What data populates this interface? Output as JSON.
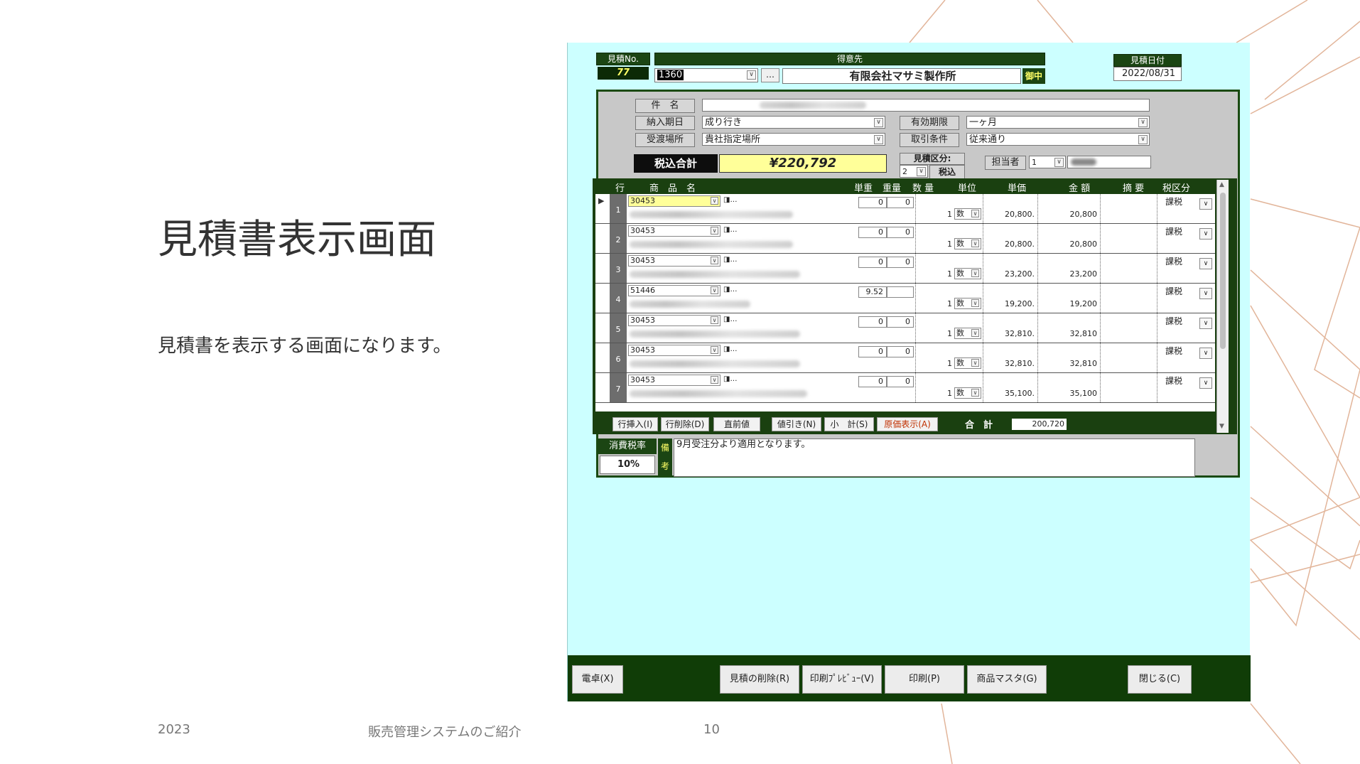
{
  "slide": {
    "title": "見積書表示画面",
    "subtitle": "見積書を表示する画面になります。",
    "footer_year": "2023",
    "footer_name": "販売管理システムのご紹介",
    "page_number": "10"
  },
  "app": {
    "estimate_no_label": "見積No.",
    "estimate_no": "77",
    "customer_label": "得意先",
    "customer_code": "1360",
    "customer_lookup": "…",
    "customer_name": "有限会社マサミ製作所",
    "honorific": "御中",
    "date_label": "見積日付",
    "date": "2022/08/31",
    "subject_label": "件　名",
    "delivery_label": "納入期日",
    "delivery_value": "成り行き",
    "place_label": "受渡場所",
    "place_value": "貴社指定場所",
    "validity_label": "有効期限",
    "validity_value": "一ヶ月",
    "terms_label": "取引条件",
    "terms_value": "従来通り",
    "tax_total_label": "税込合計",
    "tax_total_value": "¥220,792",
    "kubun_label": "見積区分:",
    "kubun_num": "2",
    "kubun_value": "税込",
    "staff_label": "担当者",
    "staff_num": "1",
    "grid_headers": {
      "line": "行",
      "product": "商　品　名",
      "unit_weight": "単重",
      "weight": "重量",
      "qty": "数 量",
      "unit": "単位",
      "price": "単価",
      "amount": "金 額",
      "memo": "摘 要",
      "tax_type": "税区分"
    },
    "rows": [
      {
        "no": "1",
        "code": "30453",
        "uw": "0",
        "w": "0",
        "qty": "1",
        "unit": "数",
        "price": "20,800.",
        "amount": "20,800",
        "tax": "課税"
      },
      {
        "no": "2",
        "code": "30453",
        "uw": "0",
        "w": "0",
        "qty": "1",
        "unit": "数",
        "price": "20,800.",
        "amount": "20,800",
        "tax": "課税"
      },
      {
        "no": "3",
        "code": "30453",
        "uw": "0",
        "w": "0",
        "qty": "1",
        "unit": "数",
        "price": "23,200.",
        "amount": "23,200",
        "tax": "課税"
      },
      {
        "no": "4",
        "code": "51446",
        "uw": "9.52",
        "w": "",
        "qty": "1",
        "unit": "数",
        "price": "19,200.",
        "amount": "19,200",
        "tax": "課税"
      },
      {
        "no": "5",
        "code": "30453",
        "uw": "0",
        "w": "0",
        "qty": "1",
        "unit": "数",
        "price": "32,810.",
        "amount": "32,810",
        "tax": "課税"
      },
      {
        "no": "6",
        "code": "30453",
        "uw": "0",
        "w": "0",
        "qty": "1",
        "unit": "数",
        "price": "32,810.",
        "amount": "32,810",
        "tax": "課税"
      },
      {
        "no": "7",
        "code": "30453",
        "uw": "0",
        "w": "0",
        "qty": "1",
        "unit": "数",
        "price": "35,100.",
        "amount": "35,100",
        "tax": "課税"
      }
    ],
    "grid_buttons": {
      "insert": "行挿入(I)",
      "delete": "行削除(D)",
      "prev": "直前値",
      "discount": "値引き(N)",
      "subtotal": "小　計(S)",
      "cost": "原価表示(A)"
    },
    "total_label": "合　計",
    "total_value": "200,720",
    "tax_rate_label": "消費税率",
    "tax_rate": "10%",
    "remarks_label_1": "備",
    "remarks_label_2": "考",
    "remarks": "9月受注分より適用となります。",
    "bottom_buttons": {
      "calc": "電卓(X)",
      "delete_estimate": "見積の削除(R)",
      "preview": "印刷ﾌﾟﾚﾋﾞｭｰ(V)",
      "print": "印刷(P)",
      "product_master": "商品マスタ(G)",
      "close": "閉じる(C)"
    }
  }
}
